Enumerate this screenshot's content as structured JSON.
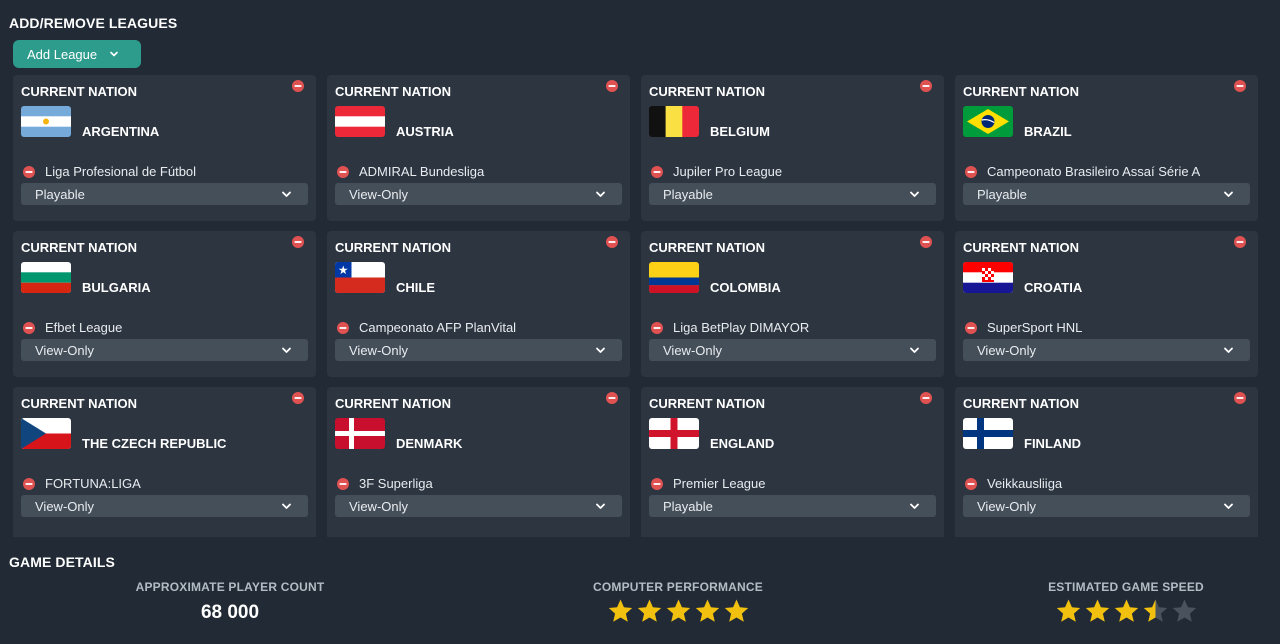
{
  "title": "ADD/REMOVE LEAGUES",
  "add_button_label": "Add League",
  "nation_label": "CURRENT NATION",
  "nations": [
    {
      "name": "ARGENTINA",
      "flag": "flag-argentina",
      "league": "Liga Profesional de Fútbol",
      "mode": "Playable"
    },
    {
      "name": "AUSTRIA",
      "flag": "flag-austria",
      "league": "ADMIRAL Bundesliga",
      "mode": "View-Only"
    },
    {
      "name": "BELGIUM",
      "flag": "flag-belgium",
      "league": "Jupiler Pro League",
      "mode": "Playable"
    },
    {
      "name": "BRAZIL",
      "flag": "flag-brazil",
      "league": "Campeonato Brasileiro Assaí Série A",
      "mode": "Playable"
    },
    {
      "name": "BULGARIA",
      "flag": "flag-bulgaria",
      "league": "Efbet League",
      "mode": "View-Only"
    },
    {
      "name": "CHILE",
      "flag": "flag-chile",
      "league": "Campeonato AFP PlanVital",
      "mode": "View-Only"
    },
    {
      "name": "COLOMBIA",
      "flag": "flag-colombia",
      "league": "Liga BetPlay DIMAYOR",
      "mode": "View-Only"
    },
    {
      "name": "CROATIA",
      "flag": "flag-croatia",
      "league": "SuperSport HNL",
      "mode": "View-Only"
    },
    {
      "name": "THE CZECH REPUBLIC",
      "flag": "flag-czech-republic",
      "league": "FORTUNA:LIGA",
      "mode": "View-Only"
    },
    {
      "name": "DENMARK",
      "flag": "flag-denmark",
      "league": "3F Superliga",
      "mode": "View-Only"
    },
    {
      "name": "ENGLAND",
      "flag": "flag-england",
      "league": "Premier League",
      "mode": "Playable"
    },
    {
      "name": "FINLAND",
      "flag": "flag-finland",
      "league": "Veikkausliiga",
      "mode": "View-Only"
    }
  ],
  "game_details": {
    "title": "GAME DETAILS",
    "player_count_label": "APPROXIMATE PLAYER COUNT",
    "player_count_value": "68 000",
    "performance_label": "COMPUTER PERFORMANCE",
    "performance_stars": 5,
    "speed_label": "ESTIMATED GAME SPEED",
    "speed_stars": 3.5,
    "max_stars": 5
  },
  "colors": {
    "accent": "#2d9c8c",
    "remove": "#e05252",
    "star": "#f2c10f",
    "star_empty": "#4a535d"
  }
}
